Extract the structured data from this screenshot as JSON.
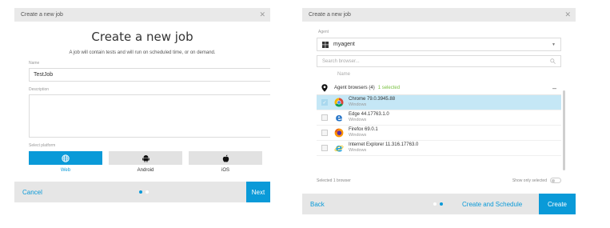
{
  "dialog1": {
    "title": "Create a new job",
    "close_glyph": "✕",
    "heading": "Create a new job",
    "subtitle": "A job will contain tests and will run on scheduled time, or on demand.",
    "name_label": "Name",
    "name_value": "TestJob",
    "description_label": "Description",
    "platform_label": "Select platform",
    "platforms": [
      {
        "label": "Web",
        "icon": "globe-icon",
        "active": true
      },
      {
        "label": "Android",
        "icon": "android-icon",
        "active": false
      },
      {
        "label": "iOS",
        "icon": "apple-icon",
        "active": false
      }
    ],
    "cancel_label": "Cancel",
    "next_label": "Next",
    "step": 1,
    "steps_total": 2
  },
  "dialog2": {
    "title": "Create a new job",
    "close_glyph": "✕",
    "agent_label": "Agent",
    "agent_value": "myagent",
    "search_placeholder": "Search browser...",
    "column_name": "Name",
    "group_label": "Agent browsers (4)",
    "group_selected": "1 selected",
    "browsers": [
      {
        "name": "Chrome 79.0.3945.88",
        "os": "Windows",
        "icon": "chrome-icon",
        "selected": true
      },
      {
        "name": "Edge 44.17763.1.0",
        "os": "Windows",
        "icon": "edge-icon",
        "selected": false
      },
      {
        "name": "Firefox 69.0.1",
        "os": "Windows",
        "icon": "firefox-icon",
        "selected": false
      },
      {
        "name": "Internet Explorer 11.316.17763.0",
        "os": "Windows",
        "icon": "ie-icon",
        "selected": false
      }
    ],
    "status_text": "Selected 1 browser",
    "show_only_label": "Show only selected",
    "show_only_on": false,
    "back_label": "Back",
    "create_schedule_label": "Create and Schedule",
    "create_label": "Create",
    "step": 2,
    "steps_total": 2
  },
  "colors": {
    "accent": "#0a9ad8",
    "selected_row": "#c5e7f6",
    "footer": "#e6e6e6",
    "selected_count": "#7ac143"
  }
}
